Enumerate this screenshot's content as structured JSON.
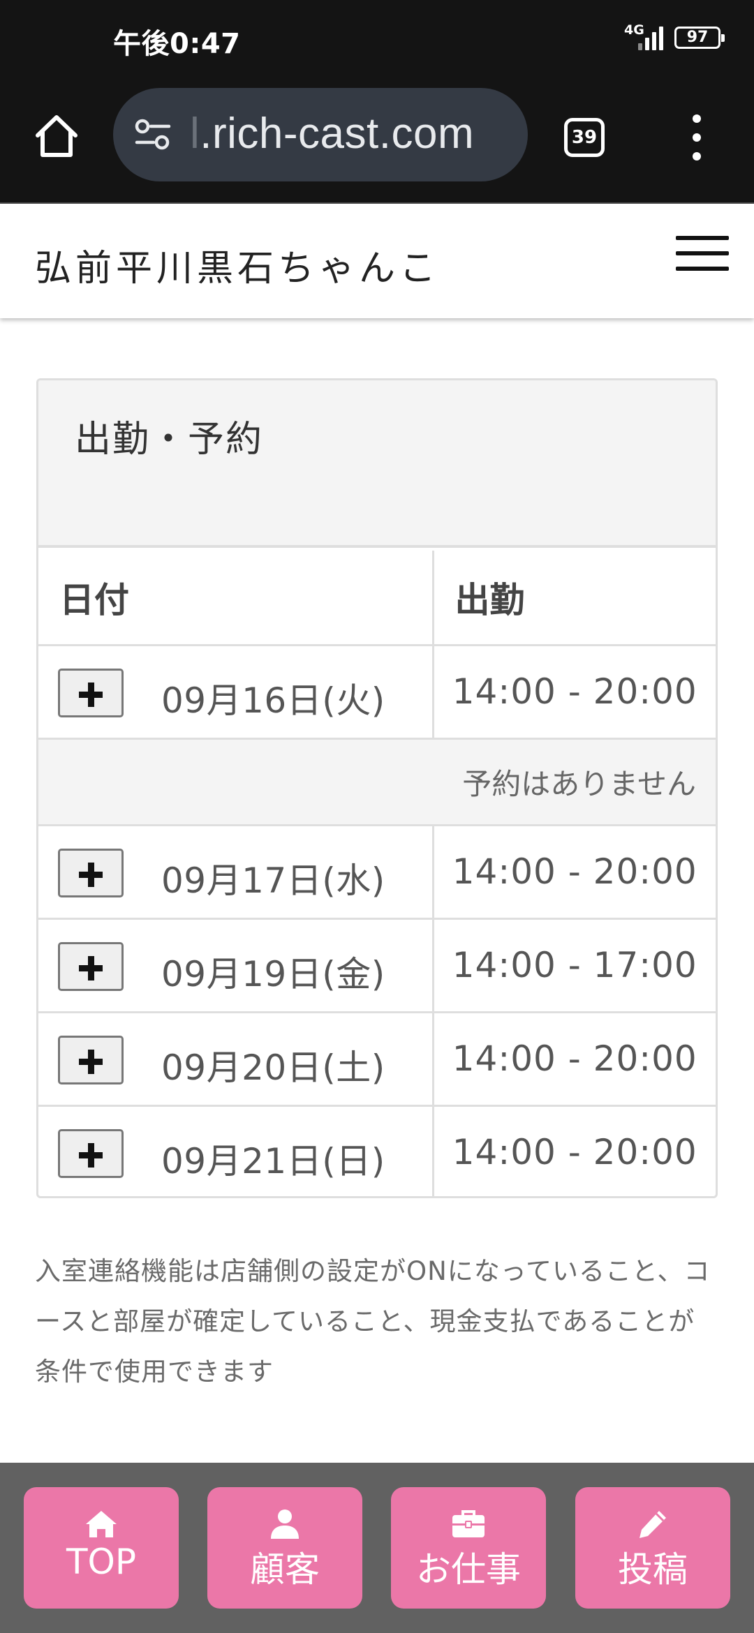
{
  "status_bar": {
    "time": "午後0:47",
    "network": "4G",
    "battery": "97"
  },
  "browser": {
    "url_faded": "l",
    "url": ".rich-cast.com",
    "tab_count": "39",
    "icons": [
      "home-icon",
      "site-settings-icon",
      "tabs-icon",
      "overflow-menu-icon"
    ]
  },
  "header": {
    "title": "弘前平川黒石ちゃんこ",
    "menu_icon": "hamburger-menu-icon"
  },
  "panel": {
    "title": "出勤・予約",
    "columns": [
      "日付",
      "出勤"
    ],
    "rows": [
      {
        "date": "09月16日(火)",
        "time": "14:00 - 20:00"
      },
      {
        "date": "09月17日(水)",
        "time": "14:00 - 20:00"
      },
      {
        "date": "09月19日(金)",
        "time": "14:00 - 17:00"
      },
      {
        "date": "09月20日(土)",
        "time": "14:00 - 20:00"
      },
      {
        "date": "09月21日(日)",
        "time": "14:00 - 20:00"
      }
    ],
    "no_reservation": "予約はありません"
  },
  "info_text": "入室連絡機能は店舗側の設定がONになっていること、コースと部屋が確定していること、現金支払であることが条件で使用できます",
  "bottom_nav": [
    {
      "label": "TOP",
      "icon": "home-icon"
    },
    {
      "label": "顧客",
      "icon": "user-icon"
    },
    {
      "label": "お仕事",
      "icon": "briefcase-icon"
    },
    {
      "label": "投稿",
      "icon": "pencil-icon"
    }
  ],
  "colors": {
    "nav_button": "#eb77a8",
    "nav_bg": "#616161",
    "chrome_bg": "#141414",
    "url_pill": "#343a44"
  }
}
